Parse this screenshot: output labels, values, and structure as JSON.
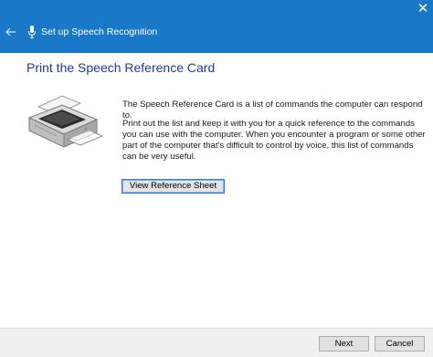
{
  "window": {
    "title": "Set up Speech Recognition",
    "close_glyph": "✕",
    "accent_color": "#1a78c8"
  },
  "page": {
    "heading": "Print the Speech Reference Card",
    "heading_color": "#1e3c9c",
    "description_1": "The Speech Reference Card is a list of commands the computer can respond to.",
    "description_2": "Print out the list and keep it with you for a quick reference to the commands you can use with the computer. When you encounter a program or some other part of the computer that's difficult to control by voice, this list of commands can be very useful.",
    "illustration_icon": "printer-icon"
  },
  "buttons": {
    "view_reference_sheet": "View Reference Sheet",
    "next": "Next",
    "cancel": "Cancel"
  },
  "icons": {
    "back": "back-arrow-icon",
    "microphone": "microphone-icon",
    "close": "close-icon"
  }
}
